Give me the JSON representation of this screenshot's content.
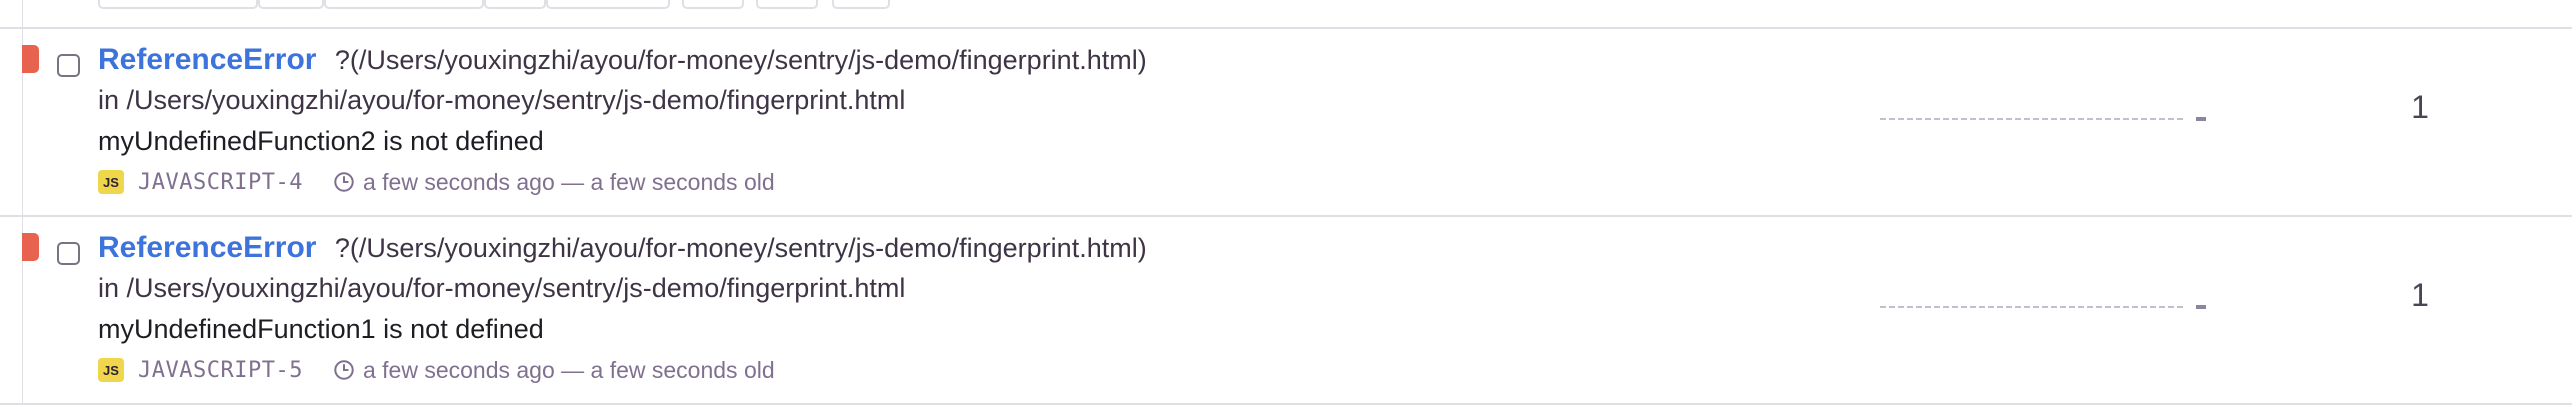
{
  "colors": {
    "level_error": "#e8634f",
    "title_link": "#3d74db",
    "badge_js": "#f0d64b",
    "muted": "#80708f"
  },
  "issues": [
    {
      "title": "ReferenceError",
      "culprit_inline": "?(/Users/youxingzhi/ayou/for-money/sentry/js-demo/fingerprint.html)",
      "location": "in /Users/youxingzhi/ayou/for-money/sentry/js-demo/fingerprint.html",
      "message": "myUndefinedFunction2 is not defined",
      "badge": "JS",
      "badge_icon": "javascript-platform-icon",
      "short_id": "JAVASCRIPT-4",
      "time_icon": "clock-icon",
      "time": "a few seconds ago — a few seconds old",
      "events": "1"
    },
    {
      "title": "ReferenceError",
      "culprit_inline": "?(/Users/youxingzhi/ayou/for-money/sentry/js-demo/fingerprint.html)",
      "location": "in /Users/youxingzhi/ayou/for-money/sentry/js-demo/fingerprint.html",
      "message": "myUndefinedFunction1 is not defined",
      "badge": "JS",
      "badge_icon": "javascript-platform-icon",
      "short_id": "JAVASCRIPT-5",
      "time_icon": "clock-icon",
      "time": "a few seconds ago — a few seconds old",
      "events": "1"
    }
  ]
}
